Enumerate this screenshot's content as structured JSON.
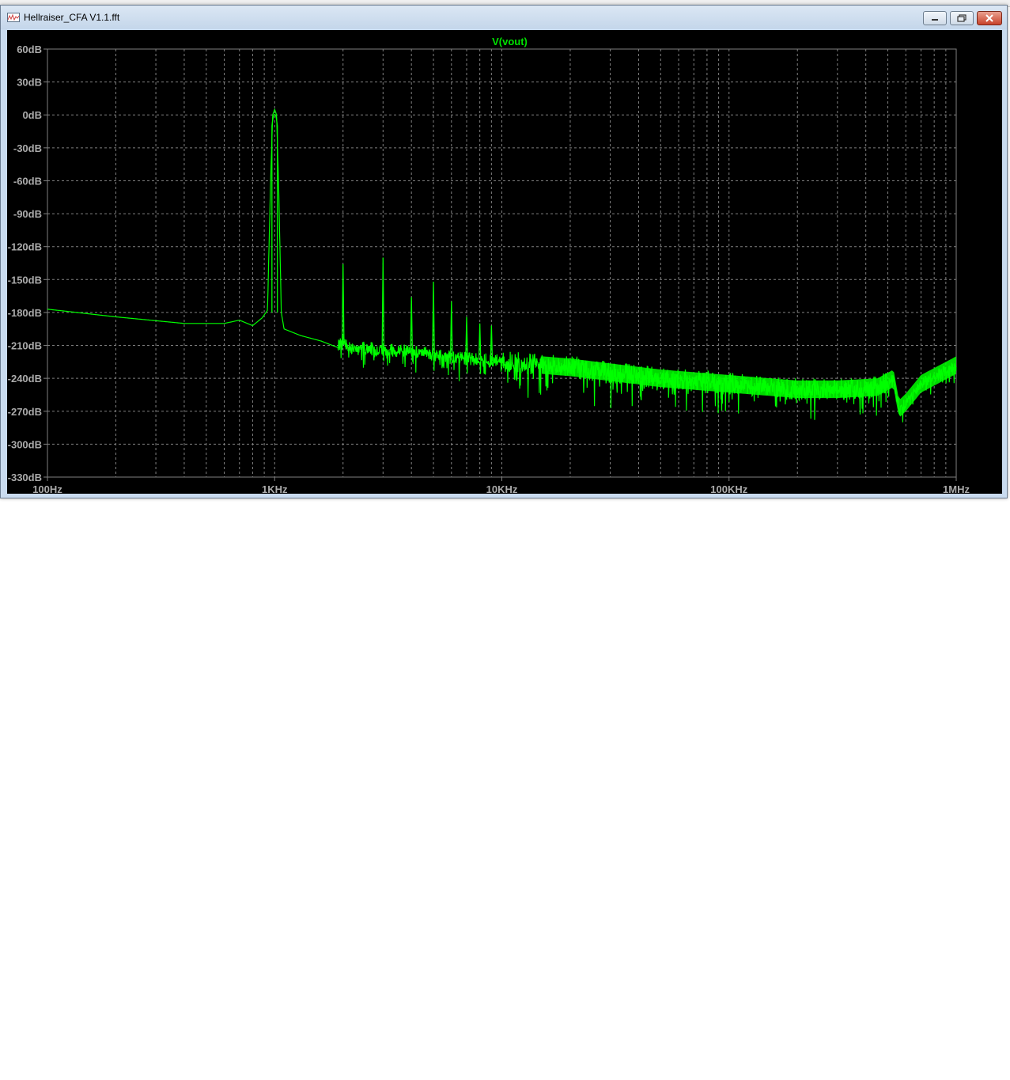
{
  "window": {
    "title": "Hellraiser_CFA V1.1.fft",
    "icon": "waveform-icon",
    "buttons": {
      "minimize": "minimize-icon",
      "maximize": "maximize-icon",
      "close": "close-icon"
    }
  },
  "colors": {
    "plot_bg": "#000000",
    "trace": "#00ff00",
    "grid": "#808080",
    "labels": "#ababab",
    "trace_title": "#00e000"
  },
  "chart_data": {
    "type": "line",
    "title": "V(vout)",
    "xscale": "log",
    "xlim": [
      100,
      1000000
    ],
    "ylim": [
      -330,
      60
    ],
    "x_ticks": [
      "100Hz",
      "1KHz",
      "10KHz",
      "100KHz",
      "1MHz"
    ],
    "y_ticks": [
      "60dB",
      "30dB",
      "0dB",
      "-30dB",
      "-60dB",
      "-90dB",
      "-120dB",
      "-150dB",
      "-180dB",
      "-210dB",
      "-240dB",
      "-270dB",
      "-300dB",
      "-330dB"
    ],
    "grid": true,
    "series": [
      {
        "name": "V(vout)",
        "x": [
          100,
          200,
          400,
          600,
          700,
          800,
          880,
          930,
          960,
          980,
          1000,
          1020,
          1040,
          1070,
          1100,
          1300,
          1600,
          1900,
          2000,
          2100,
          3000,
          4000,
          5000,
          6000,
          7000,
          8000,
          9000,
          10000,
          20000,
          50000,
          100000,
          200000,
          300000,
          450000,
          530000,
          560000,
          600000,
          700000,
          1000000
        ],
        "y": [
          -177,
          -184,
          -190,
          -190,
          -187,
          -192,
          -185,
          -178,
          -60,
          0,
          5,
          0,
          -60,
          -180,
          -195,
          -201,
          -206,
          -212,
          -205,
          -212,
          -214,
          -216,
          -217,
          -220,
          -222,
          -223,
          -224,
          -225,
          -230,
          -240,
          -245,
          -250,
          -250,
          -248,
          -240,
          -268,
          -262,
          -245,
          -228
        ]
      }
    ],
    "peaks": [
      {
        "x": 1000,
        "y": 5
      },
      {
        "x": 2000,
        "y": -136
      },
      {
        "x": 3000,
        "y": -130
      },
      {
        "x": 4000,
        "y": -166
      },
      {
        "x": 5000,
        "y": -152
      },
      {
        "x": 6000,
        "y": -170
      },
      {
        "x": 7000,
        "y": -184
      },
      {
        "x": 8000,
        "y": -190
      },
      {
        "x": 9000,
        "y": -192
      }
    ]
  }
}
